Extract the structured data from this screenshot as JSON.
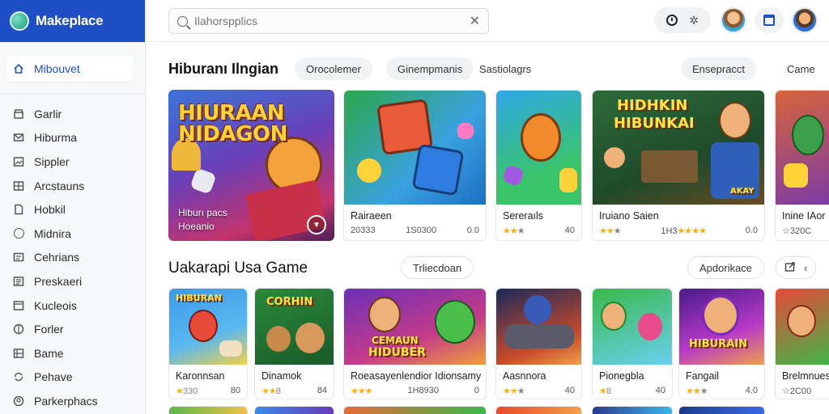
{
  "brand": {
    "name": "Makeplace",
    "logo_icon": "app-logo-icon",
    "color": "#1e4fc4"
  },
  "sidebar": {
    "active": {
      "label": "Mibouvet",
      "icon": "home-icon"
    },
    "items": [
      {
        "label": "Garlir",
        "icon": "store-icon"
      },
      {
        "label": "Hiburma",
        "icon": "mail-icon"
      },
      {
        "label": "Sippler",
        "icon": "image-icon"
      },
      {
        "label": "Arcstauns",
        "icon": "grid-icon"
      },
      {
        "label": "Hobkil",
        "icon": "file-icon"
      },
      {
        "label": "Midnira",
        "icon": "circle-icon"
      },
      {
        "label": "Cehrians",
        "icon": "card-icon"
      },
      {
        "label": "Preskaeri",
        "icon": "list-icon"
      },
      {
        "label": "Kucleois",
        "icon": "layers-icon"
      },
      {
        "label": "Forler",
        "icon": "globe-icon"
      },
      {
        "label": "Bame",
        "icon": "table-icon"
      },
      {
        "label": "Pehave",
        "icon": "sync-icon"
      },
      {
        "label": "Parkerphacs",
        "icon": "user-circle-icon"
      }
    ]
  },
  "search": {
    "value": "Ilahorspplics",
    "icons": [
      "search-icon",
      "close-icon"
    ]
  },
  "topbar": {
    "icons": [
      "clock-icon",
      "sparkle-icon",
      "calendar-icon"
    ],
    "avatars": [
      "avatar-1",
      "avatar-2"
    ]
  },
  "section1": {
    "title": "Hiburanı Ilngian",
    "chips": [
      "Orocolemer",
      "Ginempmanis",
      "Sastiolagrs",
      "Ensepracct",
      "Came"
    ],
    "featured": {
      "art_title_1": "HIURAAN",
      "art_title_2": "NIDAGON",
      "label_1": "Hiburı pacs",
      "label_2": "Hoeanio"
    },
    "cards": [
      {
        "title": "Rairaeen",
        "meta_left": "20333",
        "meta_mid": "1S0300",
        "meta_right": "0.0"
      },
      {
        "title": "Sereraıls",
        "stars": "★★",
        "stars_rest": "★",
        "meta_right": "40"
      },
      {
        "title": "Iruiano Saien",
        "art_title_1": "HIDHKIN",
        "art_title_2": "HIBUNKAI",
        "art_badge": "AKAY",
        "stars": "★★",
        "stars_rest": "★",
        "meta_mid": "1H3",
        "meta_mid_stars": "★★★★",
        "meta_right": "0.0"
      },
      {
        "title": "Inine IAor",
        "meta_left": "☆320C",
        "meta_right": ""
      }
    ]
  },
  "section2": {
    "title": "Uakarapi Usa Game",
    "chips": [
      "Trliecdoan",
      "Apdorikace"
    ],
    "icons": [
      "share-icon",
      "chevron-left-icon"
    ],
    "cards": [
      {
        "title": "Karonnsan",
        "stars": "★",
        "stars_rest": "330",
        "meta_right": "80",
        "art_title": "HIBURAN"
      },
      {
        "title": "Dinamok",
        "stars": "★★",
        "stars_rest": "8",
        "meta_right": "84",
        "art_title": "CORHIN"
      },
      {
        "title": "Roeasayenlendior Idionsamy",
        "stars": "★★★",
        "meta_mid": "1H8930",
        "meta_right": "0",
        "art_title_1": "CEMAUN",
        "art_title_2": "HIDUBER"
      },
      {
        "title": "Aasnnora",
        "stars": "★★",
        "stars_rest": "★",
        "meta_right": "40"
      },
      {
        "title": "Pionegbla",
        "stars": "★",
        "stars_rest": "8",
        "meta_right": "40"
      },
      {
        "title": "Fangail",
        "stars": "★★",
        "stars_rest": "★",
        "meta_right": "4.0",
        "art_title": "HIBURAIN"
      },
      {
        "title": "Brelmnues",
        "meta_left": "☆2C00",
        "meta_right": ""
      }
    ]
  }
}
